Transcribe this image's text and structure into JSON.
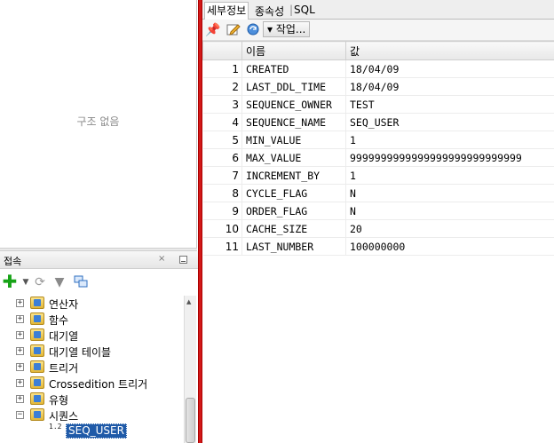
{
  "structure": {
    "empty_text": "구조 없음"
  },
  "connections": {
    "title": "접속",
    "close_glyph": "×",
    "tree": [
      {
        "label": "연산자",
        "expander": "+",
        "icon": "operator-folder-icon"
      },
      {
        "label": "함수",
        "expander": "+",
        "icon": "function-folder-icon"
      },
      {
        "label": "대기열",
        "expander": "+",
        "icon": "queue-folder-icon"
      },
      {
        "label": "대기열 테이블",
        "expander": "+",
        "icon": "queue-table-folder-icon"
      },
      {
        "label": "트리거",
        "expander": "+",
        "icon": "trigger-folder-icon"
      },
      {
        "label": "Crossedition 트리거",
        "expander": "+",
        "icon": "crossedition-trigger-folder-icon"
      },
      {
        "label": "유형",
        "expander": "+",
        "icon": "type-folder-icon"
      },
      {
        "label": "시퀀스",
        "expander": "−",
        "icon": "sequence-folder-icon"
      }
    ],
    "selected_child": {
      "label": "SEQ_USER",
      "icon_text": "1.2"
    }
  },
  "detail": {
    "tabs": [
      "세부정보",
      "종속성",
      "SQL"
    ],
    "action_label": "▾ 작업...",
    "columns": [
      "이름",
      "값"
    ],
    "rows": [
      {
        "num": "1",
        "name": "CREATED",
        "value": "18/04/09"
      },
      {
        "num": "2",
        "name": "LAST_DDL_TIME",
        "value": "18/04/09"
      },
      {
        "num": "3",
        "name": "SEQUENCE_OWNER",
        "value": "TEST"
      },
      {
        "num": "4",
        "name": "SEQUENCE_NAME",
        "value": "SEQ_USER"
      },
      {
        "num": "5",
        "name": "MIN_VALUE",
        "value": "1"
      },
      {
        "num": "6",
        "name": "MAX_VALUE",
        "value": "9999999999999999999999999999"
      },
      {
        "num": "7",
        "name": "INCREMENT_BY",
        "value": "1"
      },
      {
        "num": "8",
        "name": "CYCLE_FLAG",
        "value": "N"
      },
      {
        "num": "9",
        "name": "ORDER_FLAG",
        "value": "N"
      },
      {
        "num": "10",
        "name": "CACHE_SIZE",
        "value": "20"
      },
      {
        "num": "11",
        "name": "LAST_NUMBER",
        "value": "100000000"
      }
    ]
  },
  "colors": {
    "divider": "#d21818",
    "selection": "#1f5aa8",
    "folder": "#e3b737"
  }
}
